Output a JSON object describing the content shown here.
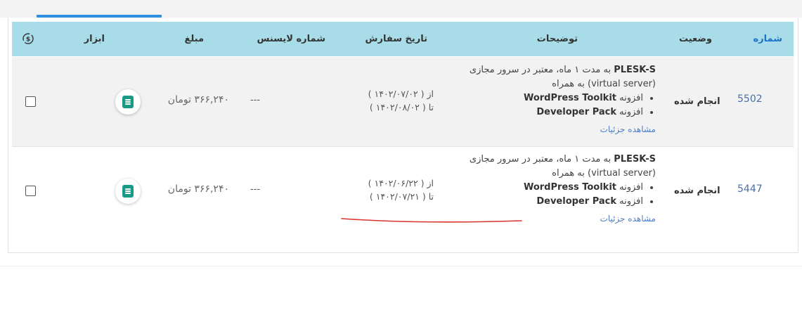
{
  "table": {
    "headers": {
      "number": "شماره",
      "status": "وضعیت",
      "description": "توضیحات",
      "order_date": "تاریخ سفارش",
      "license_number": "شماره لایسنس",
      "amount": "مبلغ",
      "tools": "ابزار"
    },
    "rows": [
      {
        "number": "5502",
        "status": "انجام شده",
        "desc_line1_product": "PLESK-S",
        "desc_line1_rest": " به مدت ۱ ماه، معتبر در سرور مجازی",
        "desc_line2": "(virtual server) به همراه",
        "addon1_prefix": "افزونه ",
        "addon1_name": "WordPress Toolkit",
        "addon2_prefix": "افزونه ",
        "addon2_name": "Developer Pack",
        "details_link": "مشاهده جزئیات",
        "date_from": "از ( ۱۴۰۲/۰۷/۰۲ )",
        "date_to": "تا ( ۱۴۰۲/۰۸/۰۲ )",
        "license": "---",
        "amount": "۳۶۶,۲۴۰ تومان"
      },
      {
        "number": "5447",
        "status": "انجام شده",
        "desc_line1_product": "PLESK-S",
        "desc_line1_rest": " به مدت ۱ ماه، معتبر در سرور مجازی",
        "desc_line2": "(virtual server) به همراه",
        "addon1_prefix": "افزونه ",
        "addon1_name": "WordPress Toolkit",
        "addon2_prefix": "افزونه ",
        "addon2_name": "Developer Pack",
        "details_link": "مشاهده جزئیات",
        "date_from": "از ( ۱۴۰۲/۰۶/۲۲ )",
        "date_to": "تا ( ۱۴۰۲/۰۷/۲۱ )",
        "license": "---",
        "amount": "۳۶۶,۲۴۰ تومان"
      }
    ]
  },
  "icons": {
    "currency_header": "currency-exchange-icon",
    "tool": "document-icon",
    "select": "checkbox"
  },
  "colors": {
    "header_bg": "#a8dce8",
    "active_tab": "#2f8fe0",
    "tool_icon": "#199a87",
    "link": "#4a7fc8",
    "annotation": "#d9342b"
  }
}
